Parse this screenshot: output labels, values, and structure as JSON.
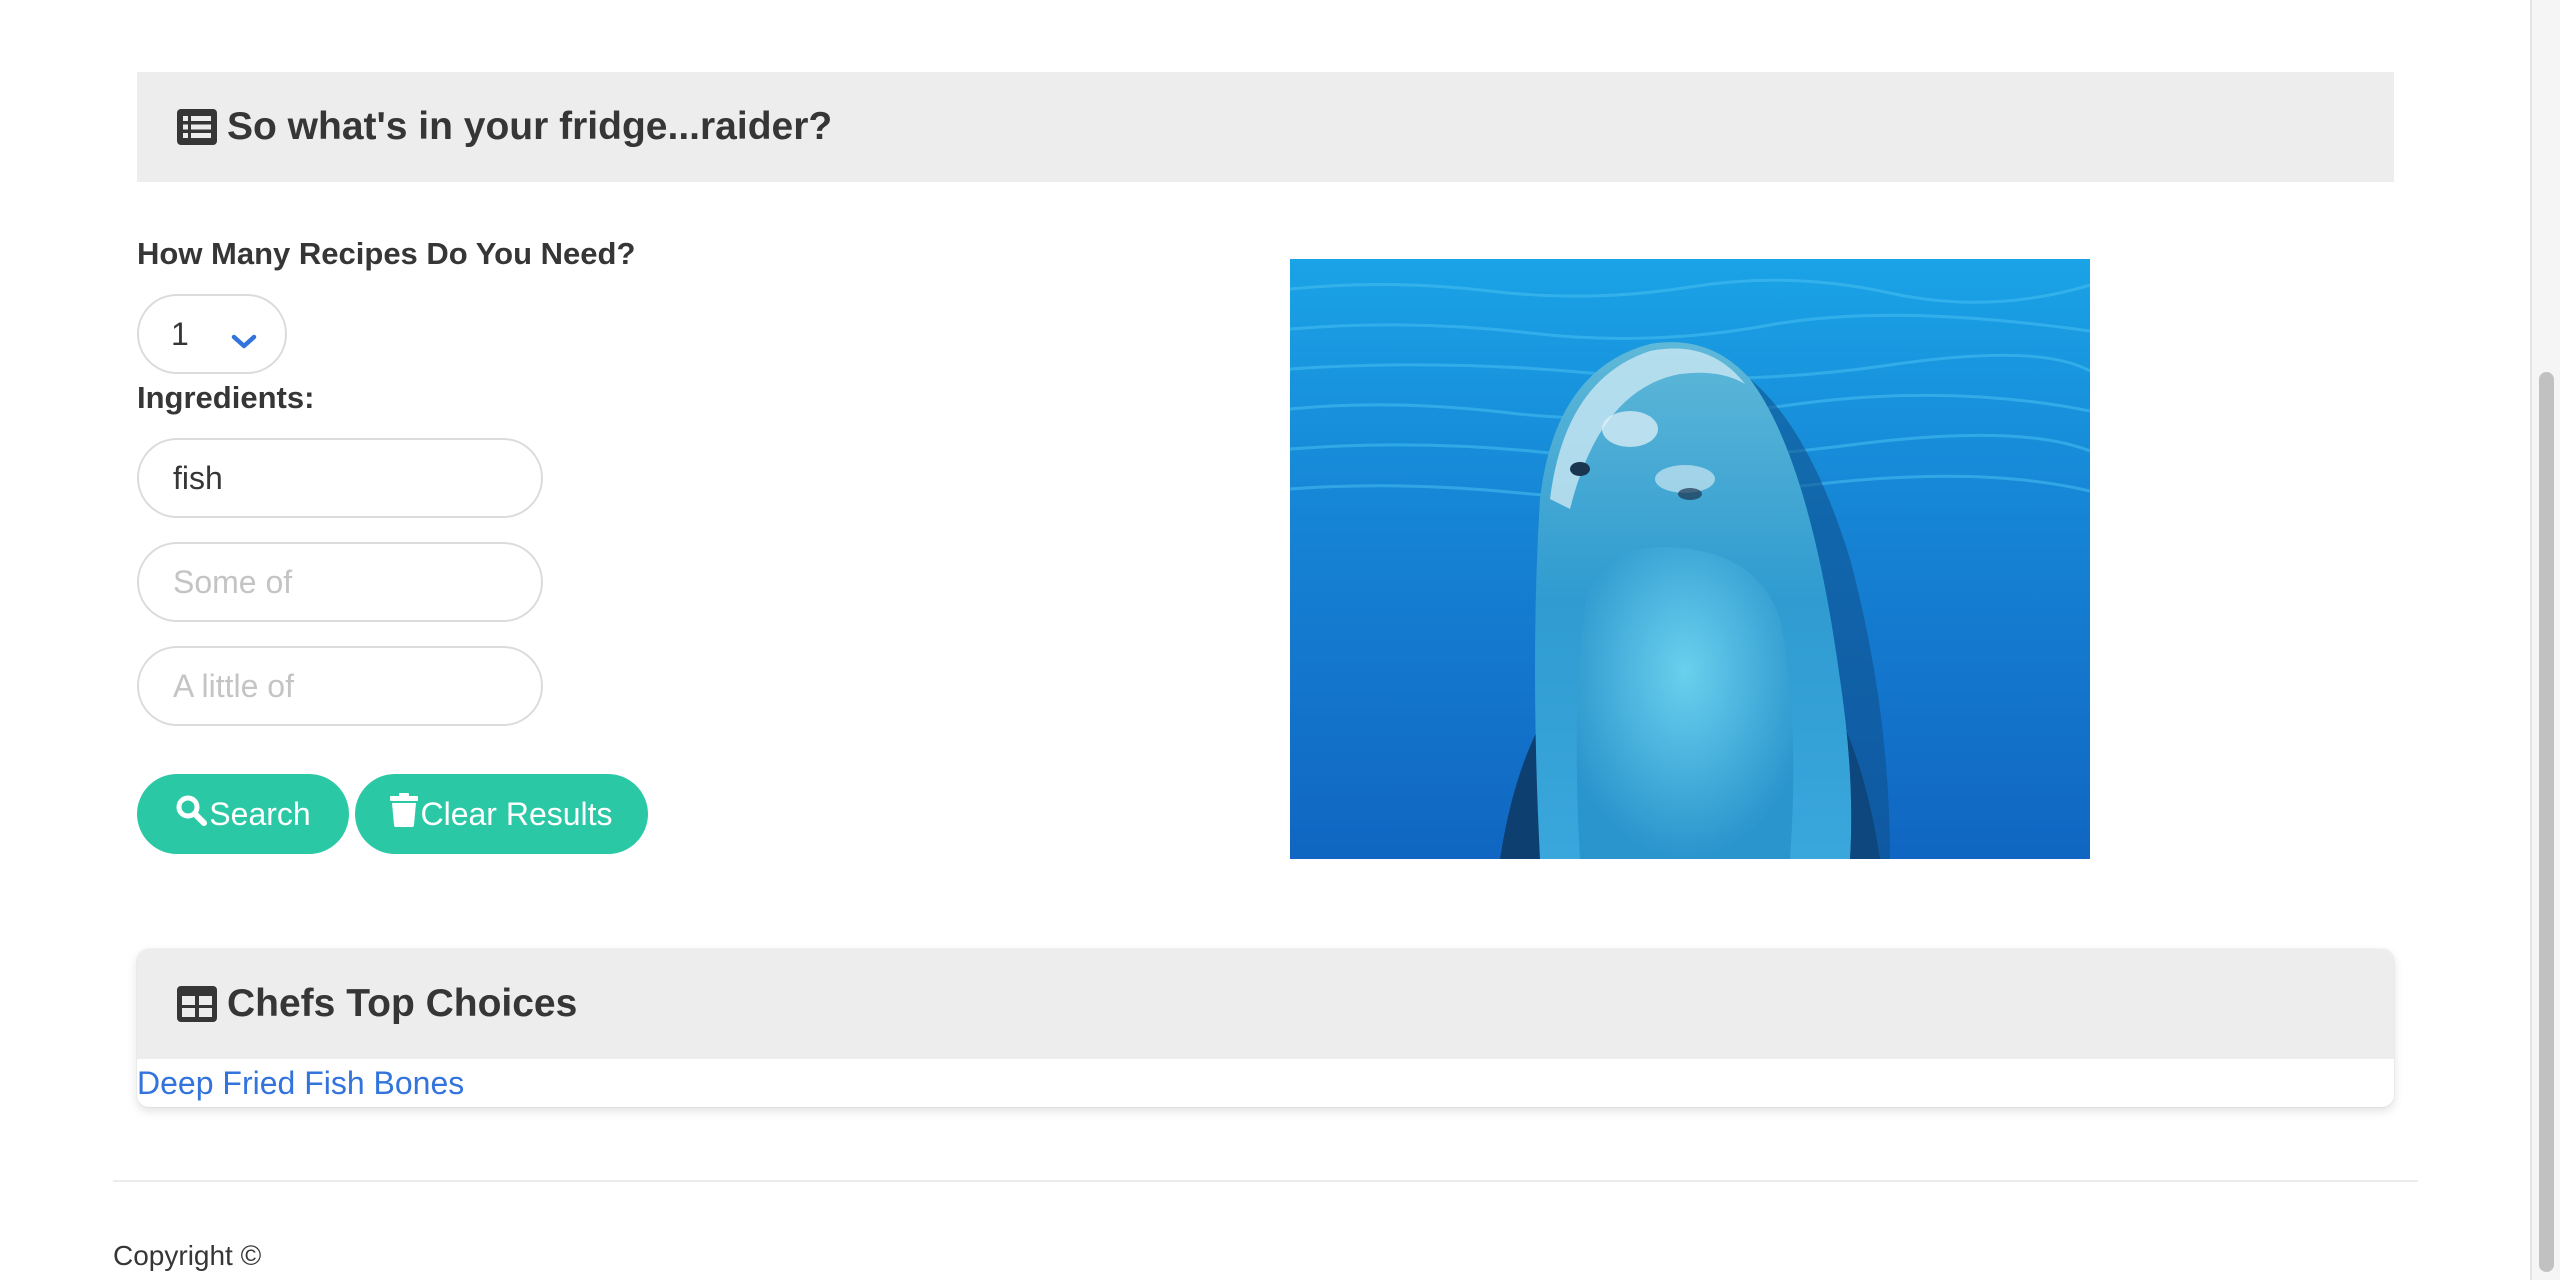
{
  "fridge_section": {
    "title": "So what's in your fridge...raider?",
    "icon": "list-icon"
  },
  "form": {
    "recipes_label": "How Many Recipes Do You Need?",
    "recipes_count": "1",
    "ingredients_label": "Ingredients:",
    "ingredient_1_value": "fish",
    "ingredient_2_placeholder": "Some of",
    "ingredient_3_placeholder": "A little of",
    "search_label": "Search",
    "clear_label": "Clear Results",
    "button_color": "#2bc8a5"
  },
  "chefs_section": {
    "title": "Chefs Top Choices",
    "icon": "table-icon",
    "recipes": [
      "Deep Fried Fish Bones"
    ],
    "link_color": "#3273dc"
  },
  "footer": {
    "copyright": "Copyright ©"
  }
}
